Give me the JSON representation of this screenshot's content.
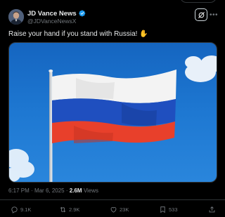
{
  "author": {
    "display_name": "JD Vance News",
    "handle": "@JDVanceNewsX",
    "verified_color": "#1d9bf0"
  },
  "header_icons": {
    "grok": "grok-icon",
    "more": "more-horizontal-icon"
  },
  "post": {
    "text": "Raise your hand if you stand with Russia! ✋",
    "media": {
      "icon": "russian-flag-photo"
    },
    "time": "6:17 PM",
    "separator": "·",
    "date": "Mar 6, 2025",
    "views_count": "2.6M",
    "views_label": "Views"
  },
  "actions": {
    "replies": "9.1K",
    "reposts": "2.9K",
    "likes": "23K",
    "bookmarks": "533"
  },
  "colors": {
    "background": "#000000",
    "text": "#e7e9ea",
    "muted": "#71767b",
    "border": "#2f3336",
    "accent": "#1d9bf0"
  }
}
